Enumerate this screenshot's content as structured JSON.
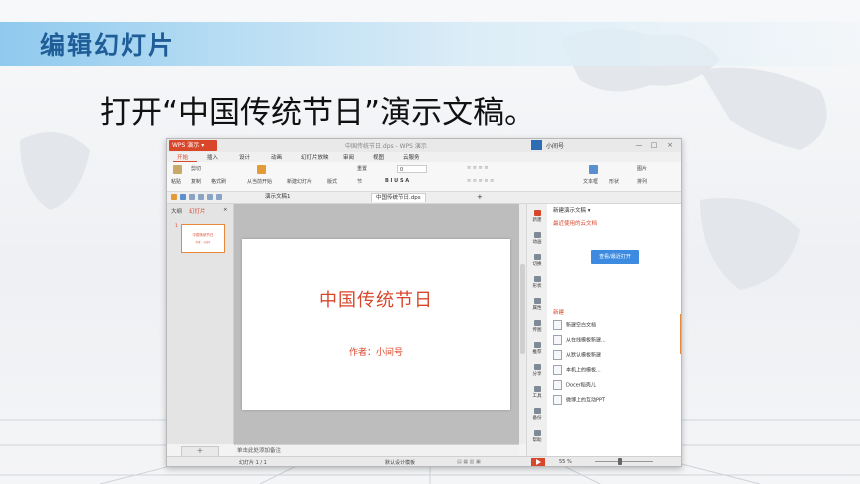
{
  "slide_heading": "编辑幻灯片",
  "instruction": "打开“中国传统节日”演示文稿。",
  "window": {
    "app_menu_label": "WPS 演示",
    "doc_title": "中国传统节日.dps - WPS 演示",
    "user_name": "小间号",
    "controls": {
      "minimize": "—",
      "restore": "□",
      "close": "×"
    }
  },
  "menu": {
    "tabs": [
      "开始",
      "插入",
      "设计",
      "动画",
      "幻灯片放映",
      "审阅",
      "视图",
      "云服务"
    ],
    "active": "开始"
  },
  "ribbon": {
    "paste": "粘贴",
    "cut": "剪切",
    "copy": "复制",
    "format_painter": "格式刷",
    "from_current": "从当前开始",
    "new_slide": "新建幻灯片",
    "layout": "版式",
    "reset": "重置",
    "section": "节",
    "font_size": "0",
    "text_box": "文本框",
    "shapes": "形状",
    "picture": "图片",
    "arrange": "排列"
  },
  "tabs": {
    "tab1": "演示文稿1",
    "tab2": "中国传统节日.dps",
    "add": "+"
  },
  "left_pane": {
    "tab_outline": "大纲",
    "tab_slides": "幻灯片",
    "close": "×",
    "thumb_number": "1",
    "add_slide": "+"
  },
  "slide": {
    "title": "中国传统节日",
    "author": "作者：小间号"
  },
  "notes_placeholder": "单击此处添加备注",
  "toolstrip": [
    "新建",
    "动画",
    "切换",
    "形状",
    "属性",
    "传图",
    "推荐",
    "分享",
    "工具",
    "备份",
    "帮助"
  ],
  "task_pane": {
    "header": "新建演示文稿 ▾",
    "recent_section": "最近使用的云文档",
    "open_cloud_button": "查看/最近打开",
    "new_section": "新建",
    "items": [
      "新建空白文档",
      "从在线模板新建...",
      "从默认模板新建",
      "本机上的模板...",
      "Docer稻壳儿",
      "微博上的互动PPT"
    ]
  },
  "status": {
    "slide_counter": "幻灯片 1 / 1",
    "template": "默认设计模板",
    "zoom": "55 %"
  },
  "colors": {
    "accent": "#d9472b",
    "heading_text": "#1e5d97",
    "heading_band": "#8fc9ee",
    "button_blue": "#3c8be0"
  }
}
